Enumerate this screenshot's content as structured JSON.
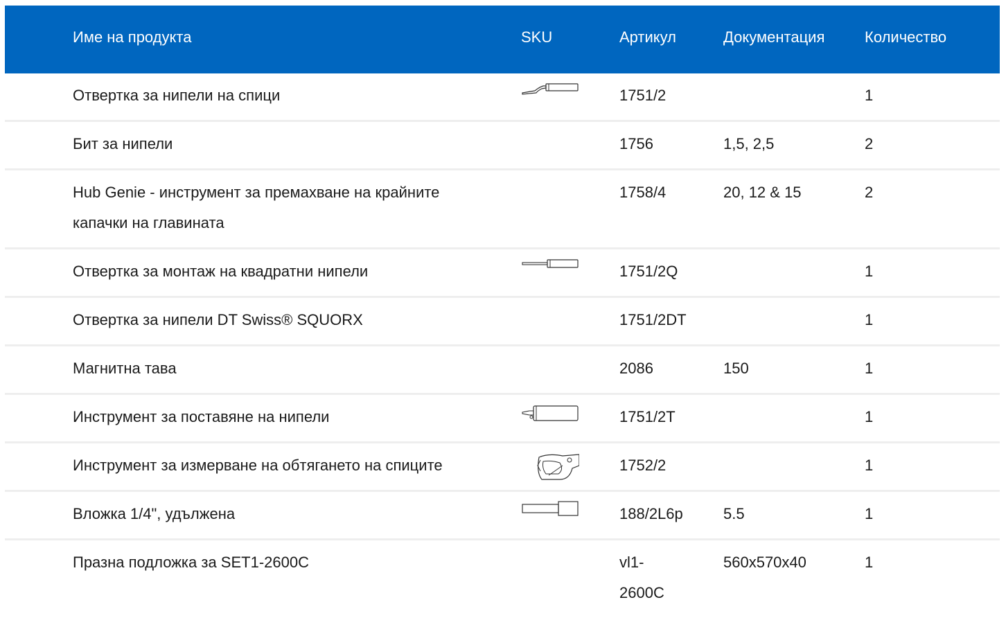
{
  "header": {
    "name": "Име на продукта",
    "sku": "SKU",
    "article": "Артикул",
    "documentation": "Документация",
    "quantity": "Количество"
  },
  "colors": {
    "header_bg": "#0066bf",
    "header_text": "#ffffff",
    "row_divider": "#eeeeee"
  },
  "rows": [
    {
      "name": "Отвертка за нипели на спици",
      "sku_icon": "spoke-wrench-icon",
      "article": "1751/2",
      "documentation": "",
      "quantity": "1"
    },
    {
      "name": "Бит за нипели",
      "sku_icon": "",
      "article": "1756",
      "documentation": "1,5, 2,5",
      "quantity": "2"
    },
    {
      "name": "Hub Genie - инструмент за премахване на крайните капачки на главината",
      "sku_icon": "",
      "article": "1758/4",
      "documentation": "20, 12 & 15",
      "quantity": "2"
    },
    {
      "name": "Отвертка за монтаж на квадратни нипели",
      "sku_icon": "screwdriver-icon",
      "article": "1751/2Q",
      "documentation": "",
      "quantity": "1"
    },
    {
      "name": "Отвертка за нипели DT Swiss® SQUORX",
      "sku_icon": "",
      "article": "1751/2DT",
      "documentation": "",
      "quantity": "1"
    },
    {
      "name": "Магнитна тава",
      "sku_icon": "",
      "article": "2086",
      "documentation": "150",
      "quantity": "1"
    },
    {
      "name": "Инструмент за поставяне на нипели",
      "sku_icon": "nipple-insert-tool-icon",
      "article": "1751/2T",
      "documentation": "",
      "quantity": "1"
    },
    {
      "name": "Инструмент за измерване на обтягането на спиците",
      "sku_icon": "tension-meter-icon",
      "article": "1752/2",
      "documentation": "",
      "quantity": "1"
    },
    {
      "name": "Вложка 1/4\", удължена",
      "sku_icon": "socket-extension-icon",
      "article": "188/2L6p",
      "documentation": "5.5",
      "quantity": "1"
    },
    {
      "name": "Празна подложка за SET1-2600C",
      "sku_icon": "",
      "article": "vl1-2600C",
      "documentation": "560x570x40",
      "quantity": "1"
    }
  ]
}
